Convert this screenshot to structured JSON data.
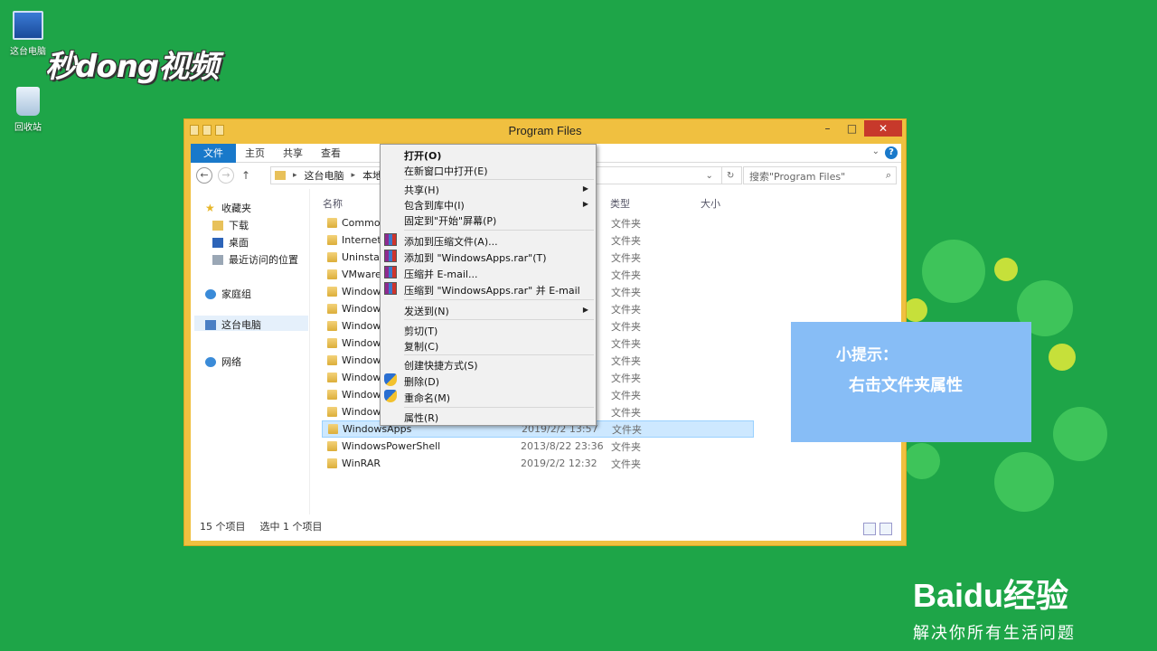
{
  "desktop": {
    "icons": [
      {
        "label": "这台电脑"
      },
      {
        "label": "回收站"
      }
    ],
    "watermark": "秒dong视频"
  },
  "window": {
    "title": "Program Files",
    "ribbon_tabs": [
      "文件",
      "主页",
      "共享",
      "查看"
    ],
    "address_path": [
      "这台电脑",
      "本地磁"
    ],
    "search_placeholder": "搜索\"Program Files\"",
    "nav": [
      {
        "label": "收藏夹"
      },
      {
        "label": "下载"
      },
      {
        "label": "桌面"
      },
      {
        "label": "最近访问的位置"
      },
      {
        "label": "家庭组"
      },
      {
        "label": "这台电脑"
      },
      {
        "label": "网络"
      }
    ],
    "columns": {
      "name": "名称",
      "type": "类型",
      "size": "大小"
    },
    "rows": [
      {
        "name": "Common",
        "date": "",
        "type": "文件夹"
      },
      {
        "name": "Internet E",
        "date": "",
        "type": "文件夹"
      },
      {
        "name": "Uninstall I",
        "date": "",
        "type": "文件夹"
      },
      {
        "name": "VMware",
        "date": "",
        "type": "文件夹"
      },
      {
        "name": "Windows",
        "date": "",
        "type": "文件夹"
      },
      {
        "name": "Windows",
        "date": "",
        "type": "文件夹"
      },
      {
        "name": "Windows",
        "date": "",
        "type": "文件夹"
      },
      {
        "name": "Windows",
        "date": "",
        "type": "文件夹"
      },
      {
        "name": "Windows",
        "date": "",
        "type": "文件夹"
      },
      {
        "name": "Windows",
        "date": "",
        "type": "文件夹"
      },
      {
        "name": "Windows",
        "date": "",
        "type": "文件夹"
      },
      {
        "name": "Windows",
        "date": "",
        "type": "文件夹"
      },
      {
        "name": "WindowsApps",
        "date": "2019/2/2 13:57",
        "type": "文件夹",
        "selected": true
      },
      {
        "name": "WindowsPowerShell",
        "date": "2013/8/22 23:36",
        "type": "文件夹"
      },
      {
        "name": "WinRAR",
        "date": "2019/2/2 12:32",
        "type": "文件夹"
      }
    ],
    "status": {
      "count": "15 个项目",
      "selected": "选中 1 个项目"
    }
  },
  "context_menu": {
    "items": [
      {
        "label": "打开(O)",
        "bold": true
      },
      {
        "label": "在新窗口中打开(E)"
      },
      {
        "label": "共享(H)",
        "submenu": true
      },
      {
        "label": "包含到库中(I)",
        "submenu": true
      },
      {
        "label": "固定到\"开始\"屏幕(P)"
      },
      {
        "label": "添加到压缩文件(A)...",
        "icon": "winrar-icon"
      },
      {
        "label": "添加到 \"WindowsApps.rar\"(T)",
        "icon": "winrar-icon"
      },
      {
        "label": "压缩并 E-mail...",
        "icon": "winrar-icon"
      },
      {
        "label": "压缩到 \"WindowsApps.rar\" 并 E-mail",
        "icon": "winrar-icon"
      },
      {
        "label": "发送到(N)",
        "submenu": true
      },
      {
        "label": "剪切(T)"
      },
      {
        "label": "复制(C)"
      },
      {
        "label": "创建快捷方式(S)"
      },
      {
        "label": "删除(D)",
        "icon": "shield-icon"
      },
      {
        "label": "重命名(M)",
        "icon": "shield-icon"
      },
      {
        "label": "属性(R)"
      }
    ]
  },
  "tip": {
    "title": "小提示：",
    "text": "右击文件夹属性"
  },
  "baidu": {
    "main": "Baidu经验",
    "sub": "解决你所有生活问题"
  }
}
